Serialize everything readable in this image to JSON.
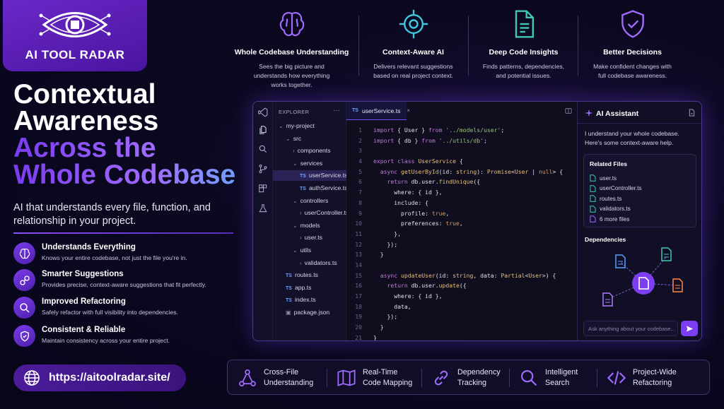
{
  "brand": {
    "name": "AI TOOL RADAR"
  },
  "headline": {
    "line1": "Contextual",
    "line2": "Awareness",
    "line3": "Across the",
    "line4": "Whole Codebase",
    "subtitle": "AI that understands every file, function, and relationship in your project."
  },
  "features": [
    {
      "title": "Understands Everything",
      "desc": "Knows your entire codebase, not just the file you're in.",
      "icon": "brain-icon"
    },
    {
      "title": "Smarter Suggestions",
      "desc": "Provides precise, context-aware suggestions that fit perfectly.",
      "icon": "link-icon"
    },
    {
      "title": "Improved Refactoring",
      "desc": "Safely refactor with full visibility into dependencies.",
      "icon": "search-icon"
    },
    {
      "title": "Consistent & Reliable",
      "desc": "Maintain consistency across your entire project.",
      "icon": "shield-icon"
    }
  ],
  "url": "https://aitoolradar.site/",
  "top_features": [
    {
      "title": "Whole Codebase Understanding",
      "desc": "Sees the big picture and\nunderstands how everything\nworks together.",
      "icon": "brain-icon"
    },
    {
      "title": "Context-Aware AI",
      "desc": "Delivers relevant suggestions\nbased on real project context.",
      "icon": "target-icon"
    },
    {
      "title": "Deep Code Insights",
      "desc": "Finds patterns, dependencies,\nand potential issues.",
      "icon": "document-icon"
    },
    {
      "title": "Better Decisions",
      "desc": "Make confident changes with\nfull codebase awareness.",
      "icon": "shield-check-icon"
    }
  ],
  "editor": {
    "explorer_label": "EXPLORER",
    "explorer_menu": "···",
    "tree": [
      {
        "label": "my-project",
        "level": 0,
        "kind": "folder-open"
      },
      {
        "label": "src",
        "level": 1,
        "kind": "folder-open"
      },
      {
        "label": "components",
        "level": 2,
        "kind": "folder"
      },
      {
        "label": "services",
        "level": 2,
        "kind": "folder-open"
      },
      {
        "label": "userService.ts",
        "level": 3,
        "kind": "ts",
        "active": true
      },
      {
        "label": "authService.ts",
        "level": 3,
        "kind": "ts"
      },
      {
        "label": "controllers",
        "level": 2,
        "kind": "folder-open"
      },
      {
        "label": "userController.ts",
        "level": 3,
        "kind": "folder"
      },
      {
        "label": "models",
        "level": 2,
        "kind": "folder-open"
      },
      {
        "label": "user.ts",
        "level": 3,
        "kind": "folder"
      },
      {
        "label": "utils",
        "level": 2,
        "kind": "folder-open"
      },
      {
        "label": "validators.ts",
        "level": 3,
        "kind": "folder"
      },
      {
        "label": "routes.ts",
        "level": 1,
        "kind": "ts"
      },
      {
        "label": "app.ts",
        "level": 1,
        "kind": "ts"
      },
      {
        "label": "index.ts",
        "level": 1,
        "kind": "ts"
      },
      {
        "label": "package.json",
        "level": 1,
        "kind": "json"
      }
    ],
    "tab": {
      "badge": "TS",
      "name": "userService.ts",
      "close": "×"
    },
    "code": [
      [
        [
          "kw",
          "import"
        ],
        [
          "p",
          " { User } "
        ],
        [
          "kw",
          "from"
        ],
        [
          "str",
          " '../models/user'"
        ],
        [
          "p",
          ";"
        ]
      ],
      [
        [
          "kw",
          "import"
        ],
        [
          "p",
          " { db } "
        ],
        [
          "kw",
          "from"
        ],
        [
          "str",
          " '../utils/db'"
        ],
        [
          "p",
          ";"
        ]
      ],
      [],
      [
        [
          "kw",
          "export class "
        ],
        [
          "ty",
          "UserService"
        ],
        [
          "p",
          " {"
        ]
      ],
      [
        [
          "p",
          "  "
        ],
        [
          "kw",
          "async "
        ],
        [
          "fn",
          "getUserById"
        ],
        [
          "p",
          "(id: "
        ],
        [
          "ty",
          "string"
        ],
        [
          "p",
          "): "
        ],
        [
          "ty",
          "Promise"
        ],
        [
          "p",
          "<"
        ],
        [
          "ty",
          "User"
        ],
        [
          "p",
          " | "
        ],
        [
          "lit",
          "null"
        ],
        [
          "p",
          "> {"
        ]
      ],
      [
        [
          "p",
          "    "
        ],
        [
          "kw",
          "return "
        ],
        [
          "p",
          "db.user."
        ],
        [
          "fn",
          "findUnique"
        ],
        [
          "p",
          "({"
        ]
      ],
      [
        [
          "p",
          "      where: { id },"
        ]
      ],
      [
        [
          "p",
          "      include: {"
        ]
      ],
      [
        [
          "p",
          "        profile: "
        ],
        [
          "lit",
          "true"
        ],
        [
          "p",
          ","
        ]
      ],
      [
        [
          "p",
          "        preferences: "
        ],
        [
          "lit",
          "true"
        ],
        [
          "p",
          ","
        ]
      ],
      [
        [
          "p",
          "      },"
        ]
      ],
      [
        [
          "p",
          "    });"
        ]
      ],
      [
        [
          "p",
          "  }"
        ]
      ],
      [],
      [
        [
          "p",
          "  "
        ],
        [
          "kw",
          "async "
        ],
        [
          "fn",
          "updateUser"
        ],
        [
          "p",
          "(id: "
        ],
        [
          "ty",
          "string"
        ],
        [
          "p",
          ", data: "
        ],
        [
          "ty",
          "Partial"
        ],
        [
          "p",
          "<"
        ],
        [
          "ty",
          "User"
        ],
        [
          "p",
          ">) {"
        ]
      ],
      [
        [
          "p",
          "    "
        ],
        [
          "kw",
          "return "
        ],
        [
          "p",
          "db.user."
        ],
        [
          "fn",
          "update"
        ],
        [
          "p",
          "({"
        ]
      ],
      [
        [
          "p",
          "      where: { id },"
        ]
      ],
      [
        [
          "p",
          "      data,"
        ]
      ],
      [
        [
          "p",
          "    });"
        ]
      ],
      [
        [
          "p",
          "  }"
        ]
      ],
      [
        [
          "p",
          "}"
        ]
      ]
    ]
  },
  "assistant": {
    "title": "AI Assistant",
    "intro": "I understand your whole codebase. Here's some context-aware help.",
    "related_title": "Related Files",
    "related": [
      "user.ts",
      "userController.ts",
      "routes.ts",
      "validators.ts",
      "6 more files"
    ],
    "dependencies_title": "Dependencies",
    "ask_placeholder": "Ask anything about your codebase..."
  },
  "bottom": [
    {
      "line1": "Cross-File",
      "line2": "Understanding",
      "icon": "network-icon"
    },
    {
      "line1": "Real-Time",
      "line2": "Code Mapping",
      "icon": "map-icon"
    },
    {
      "line1": "Dependency",
      "line2": "Tracking",
      "icon": "chain-icon"
    },
    {
      "line1": "Intelligent",
      "line2": "Search",
      "icon": "search-icon"
    },
    {
      "line1": "Project-Wide",
      "line2": "Refactoring",
      "icon": "code-icon"
    }
  ],
  "colors": {
    "accent": "#7b3ef0",
    "icon_purple": "#a06cff",
    "icon_teal": "#3ec9c9",
    "bg": "#0b0820"
  }
}
